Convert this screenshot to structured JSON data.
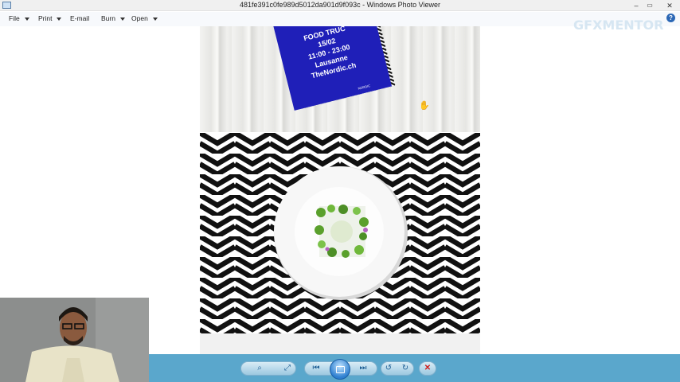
{
  "window": {
    "title": "481fe391c0fe989d5012da901d9f093c - Windows Photo Viewer",
    "minimize_glyph": "–",
    "maximize_glyph": "▭",
    "close_glyph": "✕"
  },
  "menu": {
    "items": [
      {
        "label": "File",
        "dropdown": true
      },
      {
        "label": "Print",
        "dropdown": true
      },
      {
        "label": "E-mail",
        "dropdown": false
      },
      {
        "label": "Burn",
        "dropdown": true
      },
      {
        "label": "Open",
        "dropdown": true
      }
    ],
    "help_glyph": "?"
  },
  "watermark": "GFXMENTOR",
  "photo": {
    "card_lines": [
      "FOOD TRUC",
      "15/02",
      "11:00 - 23:00",
      "Lausanne",
      "TheNordic.ch"
    ],
    "card_brand": "NORDIC",
    "card_color": "#1f1fb8"
  },
  "toolbar": {
    "zoom_glyph": "⌕",
    "fit_glyph": "⤢",
    "prev_glyph": "⏮",
    "next_glyph": "⏭",
    "rotate_ccw_glyph": "↺",
    "rotate_cw_glyph": "↻",
    "delete_glyph": "✕",
    "accent": "#5aa7cc",
    "delete_color": "#d11b1b"
  }
}
